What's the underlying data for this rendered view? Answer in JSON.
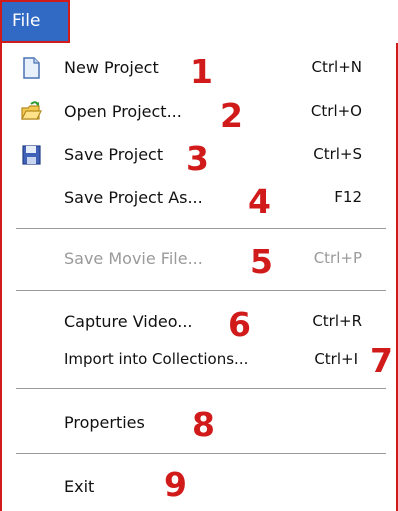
{
  "menu": {
    "title": "File",
    "items": [
      {
        "label": "New Project",
        "shortcut": "Ctrl+N",
        "annotation": "1",
        "icon": "new-project-icon",
        "enabled": true
      },
      {
        "label": "Open Project...",
        "shortcut": "Ctrl+O",
        "annotation": "2",
        "icon": "open-folder-icon",
        "enabled": true
      },
      {
        "label": "Save Project",
        "shortcut": "Ctrl+S",
        "annotation": "3",
        "icon": "save-disk-icon",
        "enabled": true
      },
      {
        "label": "Save Project As...",
        "shortcut": "F12",
        "annotation": "4",
        "enabled": true
      },
      {
        "label": "Save Movie File...",
        "shortcut": "Ctrl+P",
        "annotation": "5",
        "enabled": false
      },
      {
        "label": "Capture Video...",
        "shortcut": "Ctrl+R",
        "annotation": "6",
        "enabled": true
      },
      {
        "label": "Import into Collections...",
        "shortcut": "Ctrl+I",
        "annotation": "7",
        "enabled": true
      },
      {
        "label": "Properties",
        "shortcut": "",
        "annotation": "8",
        "enabled": true
      },
      {
        "label": "Exit",
        "shortcut": "",
        "annotation": "9",
        "enabled": true
      }
    ]
  },
  "colors": {
    "menu_highlight": "#316ac5",
    "annotation": "#d11b1b",
    "disabled_text": "#9a9a9a"
  }
}
